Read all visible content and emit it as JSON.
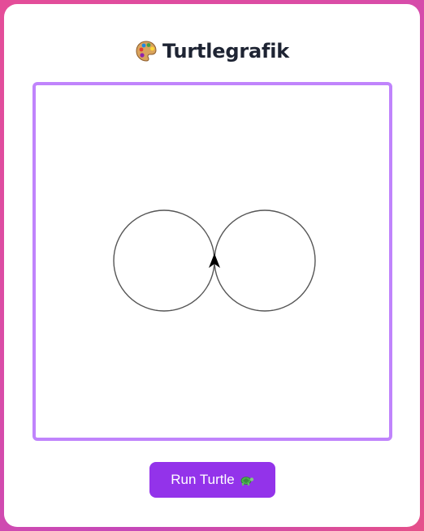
{
  "header": {
    "icon": "palette-icon",
    "title": "Turtlegrafik"
  },
  "canvas": {
    "shapes": [
      "circle",
      "circle"
    ],
    "pen_color": "#555555",
    "turtle_color": "#000000",
    "turtle_heading": "up"
  },
  "run_button": {
    "label": "Run Turtle",
    "icon": "turtle-icon"
  },
  "colors": {
    "accent": "#9333ea",
    "canvas_border": "#c084fc",
    "title": "#1e2433"
  }
}
